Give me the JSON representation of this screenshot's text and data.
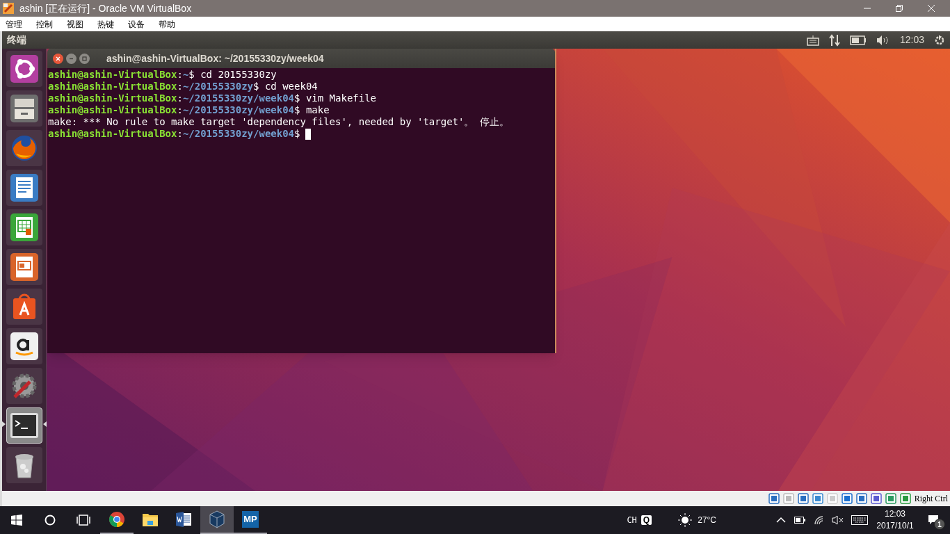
{
  "window": {
    "title": "ashin [正在运行] - Oracle VM VirtualBox"
  },
  "menu": [
    "管理",
    "控制",
    "视图",
    "热键",
    "设备",
    "帮助"
  ],
  "top_panel": {
    "app_name": "终端",
    "clock": "12:03"
  },
  "launcher": [
    {
      "selected": false
    },
    {
      "selected": false
    },
    {
      "selected": false
    },
    {
      "selected": false
    },
    {
      "selected": false
    },
    {
      "selected": false
    },
    {
      "selected": false
    },
    {
      "selected": false
    },
    {
      "selected": false
    },
    {
      "selected": true
    },
    {
      "selected": false
    }
  ],
  "terminal": {
    "title": "ashin@ashin-VirtualBox: ~/20155330zy/week04",
    "lines": [
      {
        "kind": "prompt",
        "user": "ashin@ashin-VirtualBox",
        "sep": ":",
        "path": "~",
        "symbol": "$",
        "command": " cd 20155330zy"
      },
      {
        "kind": "prompt",
        "user": "ashin@ashin-VirtualBox",
        "sep": ":",
        "path": "~/20155330zy",
        "symbol": "$",
        "command": " cd week04"
      },
      {
        "kind": "prompt",
        "user": "ashin@ashin-VirtualBox",
        "sep": ":",
        "path": "~/20155330zy/week04",
        "symbol": "$",
        "command": " vim Makefile"
      },
      {
        "kind": "prompt",
        "user": "ashin@ashin-VirtualBox",
        "sep": ":",
        "path": "~/20155330zy/week04",
        "symbol": "$",
        "command": " make"
      },
      {
        "kind": "output",
        "text": "make: *** No rule to make target 'dependency files', needed by 'target'。 停止。"
      },
      {
        "kind": "prompt",
        "user": "ashin@ashin-VirtualBox",
        "sep": ":",
        "path": "~/20155330zy/week04",
        "symbol": "$",
        "cursor": true
      }
    ]
  },
  "vbox_status": {
    "host_key": "Right Ctrl"
  },
  "taskbar": {
    "apps": [
      {
        "running": true,
        "selected": false
      },
      {
        "running": false,
        "selected": false
      },
      {
        "running": false,
        "selected": false
      },
      {
        "running": true,
        "selected": true
      },
      {
        "label": "MP",
        "running": true,
        "selected": false
      }
    ],
    "ime": "CH",
    "ime_mode": "Q",
    "temperature": "27°C",
    "time": "12:03",
    "date": "2017/10/1",
    "notifications": "1"
  }
}
